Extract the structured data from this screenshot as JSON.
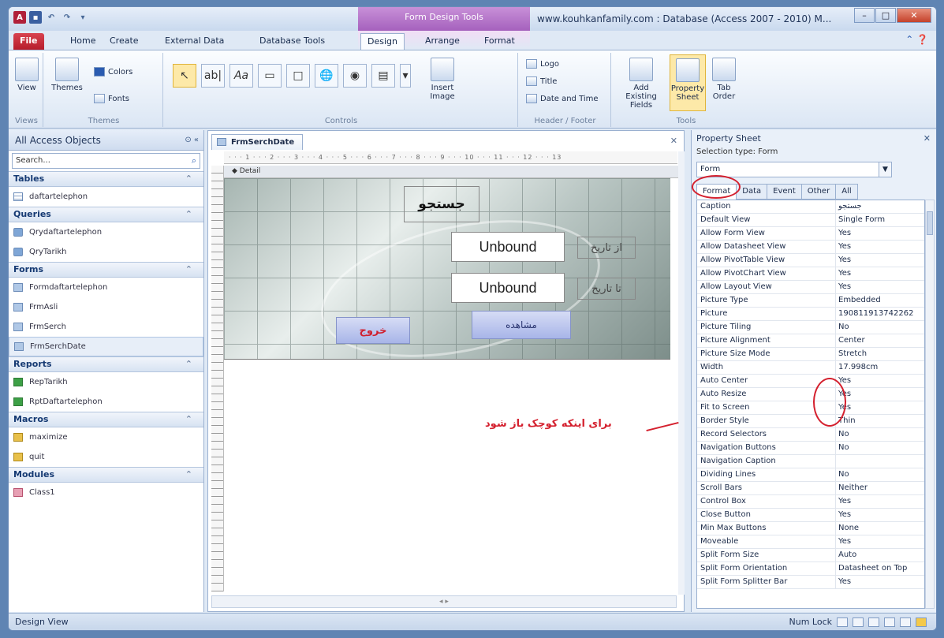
{
  "window": {
    "context_title": "Form Design Tools",
    "title": "www.kouhkanfamily.com : Database (Access 2007 - 2010) M..."
  },
  "tabs": [
    "File",
    "Home",
    "Create",
    "External Data",
    "Database Tools",
    "Design",
    "Arrange",
    "Format"
  ],
  "ribbon": {
    "views": {
      "label": "View",
      "group": "Views"
    },
    "themes": {
      "themes": "Themes",
      "colors": "Colors",
      "fonts": "Fonts",
      "group": "Themes"
    },
    "controls": {
      "group": "Controls",
      "insert_image": "Insert Image"
    },
    "header_footer": {
      "logo": "Logo",
      "title": "Title",
      "date_time": "Date and Time",
      "group": "Header / Footer"
    },
    "tools": {
      "add_fields": "Add Existing Fields",
      "property_sheet": "Property Sheet",
      "tab_order": "Tab Order",
      "group": "Tools"
    }
  },
  "nav": {
    "header": "All Access Objects",
    "search_placeholder": "Search...",
    "sections": [
      {
        "title": "Tables",
        "items": [
          "daftartelephon"
        ]
      },
      {
        "title": "Queries",
        "items": [
          "Qrydaftartelephon",
          "QryTarikh"
        ]
      },
      {
        "title": "Forms",
        "items": [
          "Formdaftartelephon",
          "FrmAsli",
          "FrmSerch",
          "FrmSerchDate"
        ]
      },
      {
        "title": "Reports",
        "items": [
          "RepTarikh",
          "RptDaftartelephon"
        ]
      },
      {
        "title": "Macros",
        "items": [
          "maximize",
          "quit"
        ]
      },
      {
        "title": "Modules",
        "items": [
          "Class1"
        ]
      }
    ]
  },
  "document": {
    "tab": "FrmSerchDate",
    "section": "Detail",
    "search_label": "جستجو",
    "unbound1": "Unbound",
    "unbound2": "Unbound",
    "from_date": "از تاریخ",
    "to_date": "تا تاریخ",
    "exit_button": "خروج",
    "view_button": "مشاهده"
  },
  "property_sheet": {
    "title": "Property Sheet",
    "selection_type": "Selection type: Form",
    "combo_value": "Form",
    "tabs": [
      "Format",
      "Data",
      "Event",
      "Other",
      "All"
    ],
    "rows": [
      [
        "Caption",
        "جستجو"
      ],
      [
        "Default View",
        "Single Form"
      ],
      [
        "Allow Form View",
        "Yes"
      ],
      [
        "Allow Datasheet View",
        "Yes"
      ],
      [
        "Allow PivotTable View",
        "Yes"
      ],
      [
        "Allow PivotChart View",
        "Yes"
      ],
      [
        "Allow Layout View",
        "Yes"
      ],
      [
        "Picture Type",
        "Embedded"
      ],
      [
        "Picture",
        "190811913742262"
      ],
      [
        "Picture Tiling",
        "No"
      ],
      [
        "Picture Alignment",
        "Center"
      ],
      [
        "Picture Size Mode",
        "Stretch"
      ],
      [
        "Width",
        "17.998cm"
      ],
      [
        "Auto Center",
        "Yes"
      ],
      [
        "Auto Resize",
        "Yes"
      ],
      [
        "Fit to Screen",
        "Yes"
      ],
      [
        "Border Style",
        "Thin"
      ],
      [
        "Record Selectors",
        "No"
      ],
      [
        "Navigation Buttons",
        "No"
      ],
      [
        "Navigation Caption",
        ""
      ],
      [
        "Dividing Lines",
        "No"
      ],
      [
        "Scroll Bars",
        "Neither"
      ],
      [
        "Control Box",
        "Yes"
      ],
      [
        "Close Button",
        "Yes"
      ],
      [
        "Min Max Buttons",
        "None"
      ],
      [
        "Moveable",
        "Yes"
      ],
      [
        "Split Form Size",
        "Auto"
      ],
      [
        "Split Form Orientation",
        "Datasheet on Top"
      ],
      [
        "Split Form Splitter Bar",
        "Yes"
      ]
    ]
  },
  "annotation": "برای اینکه کوچک باز شود",
  "status": {
    "left": "Design View",
    "right": "Num Lock"
  }
}
